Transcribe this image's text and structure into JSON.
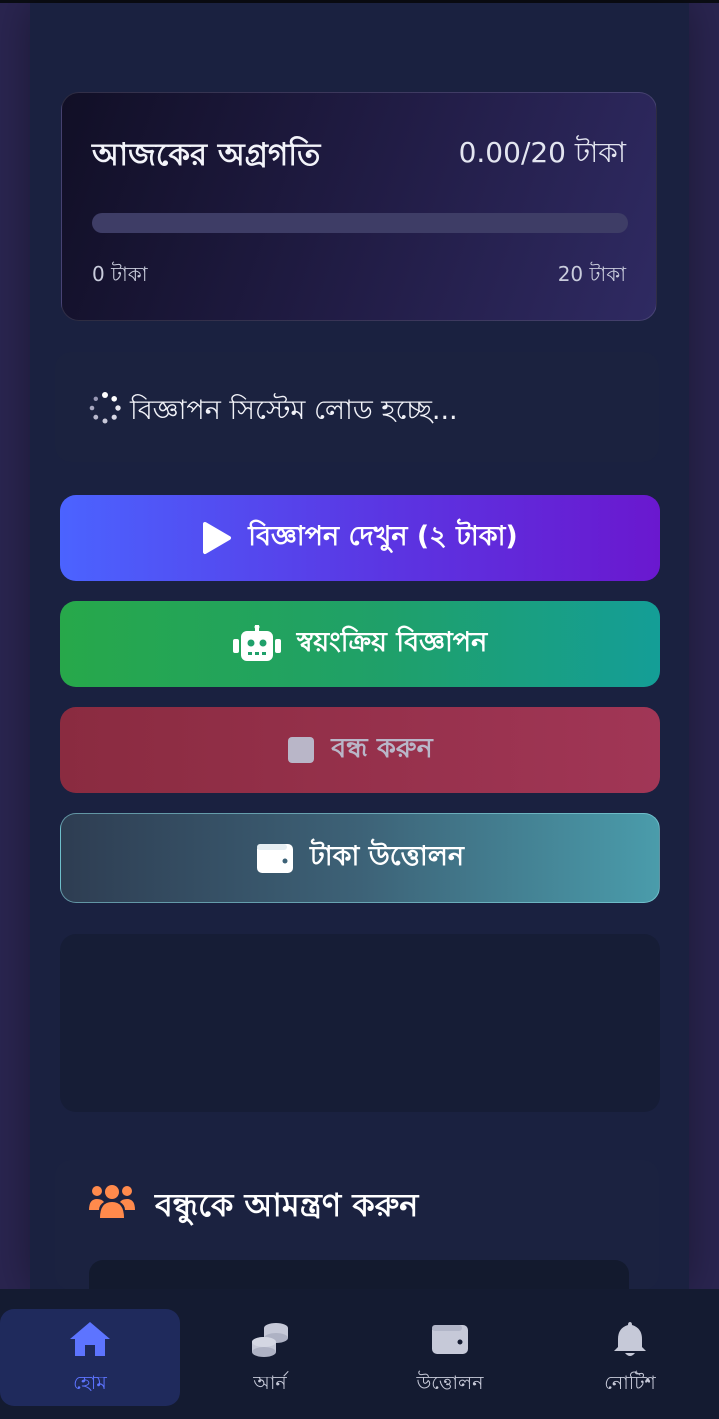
{
  "progress": {
    "title": "আজকের অগ্রগতি",
    "amount": "0.00/20 টাকা",
    "min_label": "0 টাকা",
    "max_label": "20 টাকা",
    "fraction": 0
  },
  "loading": {
    "text": "বিজ্ঞাপন সিস্টেম লোড হচ্ছে..."
  },
  "actions": {
    "watch_label": "বিজ্ঞাপন দেখুন (২ টাকা)",
    "auto_label": "স্বয়ংক্রিয় বিজ্ঞাপন",
    "stop_label": "বন্ধ করুন",
    "withdraw_label": "টাকা উত্তোলন"
  },
  "invite": {
    "title": "বন্ধুকে আমন্ত্রণ করুন"
  },
  "nav": {
    "items": [
      {
        "label": "হোম",
        "icon": "home-icon",
        "active": true
      },
      {
        "label": "আর্ন",
        "icon": "coins-icon",
        "active": false
      },
      {
        "label": "উত্তোলন",
        "icon": "wallet-icon",
        "active": false
      },
      {
        "label": "নোটিশ",
        "icon": "bell-icon",
        "active": false
      }
    ]
  },
  "colors": {
    "accent": "#5d74ff",
    "invite_icon": "#ff8a4c"
  }
}
